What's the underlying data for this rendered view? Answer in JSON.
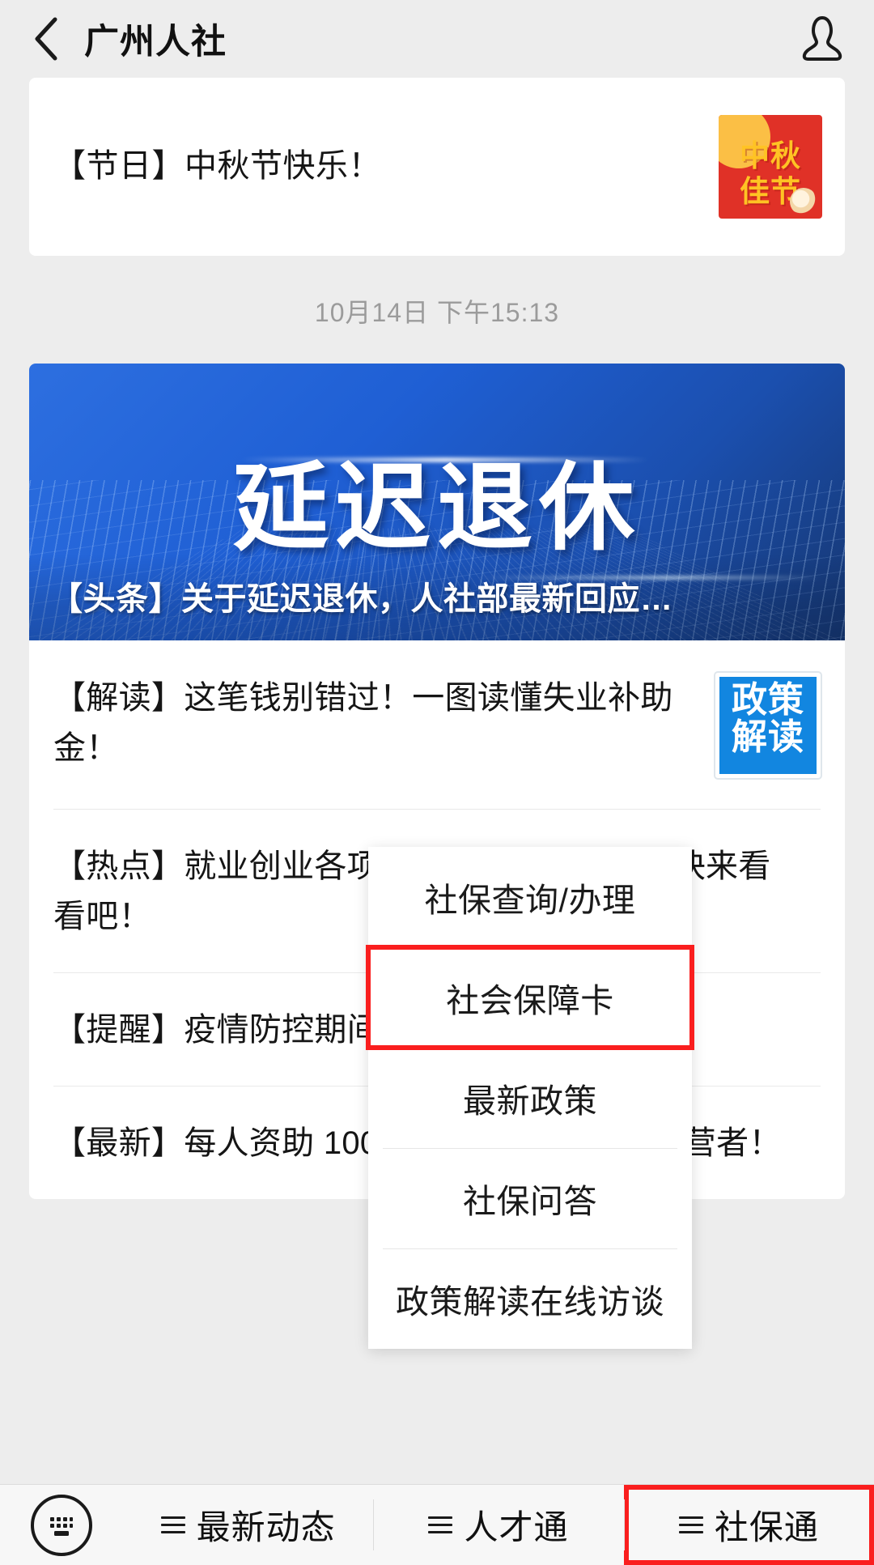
{
  "header": {
    "title": "广州人社",
    "back_icon": "chevron-left-icon",
    "contact_icon": "person-icon"
  },
  "feed": {
    "holiday_card": {
      "text": "【节日】中秋节快乐！",
      "thumb_line1": "中秋",
      "thumb_line2": "佳节"
    },
    "timestamp": "10月14日 下午15:13",
    "hero": {
      "big_text": "延迟退休",
      "caption": "【头条】关于延迟退休，人社部最新回应…"
    },
    "articles": [
      {
        "text": "【解读】这笔钱别错过！一图读懂失业补助金！",
        "thumb": "政策解读"
      },
      {
        "text": "【热点】就业创业各项补贴政策你知道吗？快来看看吧！"
      },
      {
        "text": "【提醒】疫情防控期间劳动关系你问我答！"
      },
      {
        "text": "【最新】每人资助 10000 元，500 名电商经营者！"
      }
    ]
  },
  "popup_menu": {
    "items": [
      {
        "label": "社保查询/办理",
        "highlighted": false
      },
      {
        "label": "社会保障卡",
        "highlighted": true
      },
      {
        "label": "最新政策",
        "highlighted": false
      },
      {
        "label": "社保问答",
        "highlighted": false
      },
      {
        "label": "政策解读在线访谈",
        "highlighted": false
      }
    ]
  },
  "bottom_bar": {
    "keyboard_icon": "keyboard-icon",
    "tabs": [
      {
        "label": "最新动态",
        "highlighted": false
      },
      {
        "label": "人才通",
        "highlighted": false
      },
      {
        "label": "社保通",
        "highlighted": true
      }
    ]
  },
  "colors": {
    "highlight": "#fa1e1e",
    "banner_blue": "#1f5fd4",
    "thumb_red": "#e03127",
    "thumb_blue": "#1286e0"
  }
}
